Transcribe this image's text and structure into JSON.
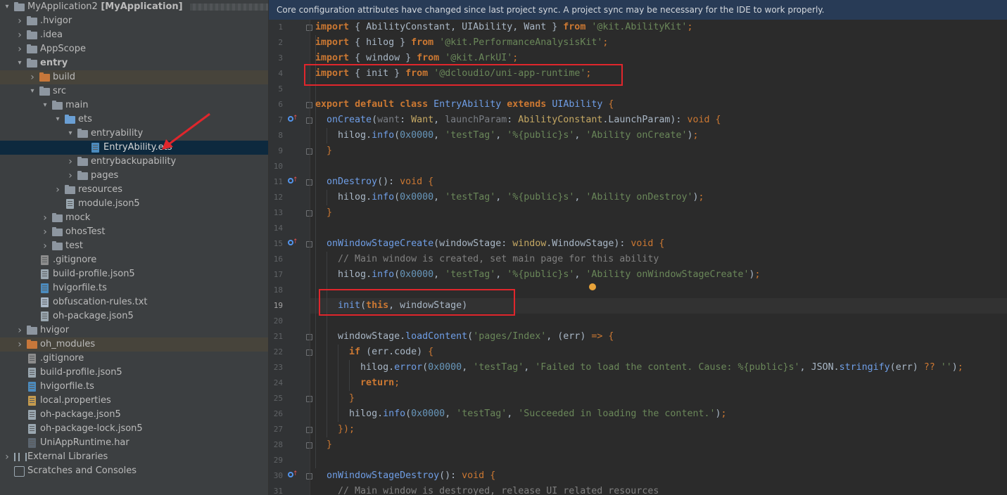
{
  "project": {
    "root_label": "MyApplication2",
    "root_module": "[MyApplication]",
    "items": [
      {
        "label": "MyApplication2",
        "icon": "folder-icon"
      },
      {
        "label": ".hvigor",
        "icon": "folder-icon"
      },
      {
        "label": ".idea",
        "icon": "folder-icon"
      },
      {
        "label": "AppScope",
        "icon": "folder-icon"
      },
      {
        "label": "entry",
        "icon": "folder-icon"
      },
      {
        "label": "build",
        "icon": "folder-orange-icon"
      },
      {
        "label": "src",
        "icon": "folder-icon"
      },
      {
        "label": "main",
        "icon": "folder-icon"
      },
      {
        "label": "ets",
        "icon": "folder-blue-icon"
      },
      {
        "label": "entryability",
        "icon": "folder-icon"
      },
      {
        "label": "EntryAbility.ets",
        "icon": "ets-file-icon"
      },
      {
        "label": "entrybackupability",
        "icon": "folder-icon"
      },
      {
        "label": "pages",
        "icon": "folder-icon"
      },
      {
        "label": "resources",
        "icon": "folder-icon"
      },
      {
        "label": "module.json5",
        "icon": "json-file-icon"
      },
      {
        "label": "mock",
        "icon": "folder-icon"
      },
      {
        "label": "ohosTest",
        "icon": "folder-icon"
      },
      {
        "label": "test",
        "icon": "folder-icon"
      },
      {
        "label": ".gitignore",
        "icon": "gitignore-file-icon"
      },
      {
        "label": "build-profile.json5",
        "icon": "json-file-icon"
      },
      {
        "label": "hvigorfile.ts",
        "icon": "ts-file-icon"
      },
      {
        "label": "obfuscation-rules.txt",
        "icon": "text-file-icon"
      },
      {
        "label": "oh-package.json5",
        "icon": "json-file-icon"
      },
      {
        "label": "hvigor",
        "icon": "folder-icon"
      },
      {
        "label": "oh_modules",
        "icon": "folder-orange-icon"
      },
      {
        "label": ".gitignore",
        "icon": "gitignore-file-icon"
      },
      {
        "label": "build-profile.json5",
        "icon": "json-file-icon"
      },
      {
        "label": "hvigorfile.ts",
        "icon": "ts-file-icon"
      },
      {
        "label": "local.properties",
        "icon": "properties-file-icon"
      },
      {
        "label": "oh-package.json5",
        "icon": "json-file-icon"
      },
      {
        "label": "oh-package-lock.json5",
        "icon": "json-file-icon"
      },
      {
        "label": "UniAppRuntime.har",
        "icon": "har-file-icon"
      },
      {
        "label": "External Libraries",
        "icon": "library-icon"
      },
      {
        "label": "Scratches and Consoles",
        "icon": "scratch-icon"
      }
    ]
  },
  "notice": {
    "text": "Core configuration attributes have changed since last project sync. A project sync may be necessary for the IDE to work properly."
  },
  "editor": {
    "line_numbers": [
      "1",
      "2",
      "3",
      "4",
      "5",
      "6",
      "7",
      "8",
      "9",
      "10",
      "11",
      "12",
      "13",
      "14",
      "15",
      "16",
      "17",
      "18",
      "19",
      "20",
      "21",
      "22",
      "23",
      "24",
      "25",
      "26",
      "27",
      "28",
      "29",
      "30",
      "31"
    ],
    "t": {
      "import": "import",
      "from": "from",
      "export": "export",
      "default": "default",
      "class": "class",
      "extends": "extends",
      "void": "void",
      "this": "this",
      "if": "if",
      "return": "return",
      "lb": "{ ",
      "rb": " }",
      "semi": ";",
      "l1_names": "AbilityConstant, UIAbility, Want",
      "l1_mod": "'@kit.AbilityKit'",
      "hilog": "hilog",
      "l2_mod": "'@kit.PerformanceAnalysisKit'",
      "window": "window",
      "l3_mod": "'@kit.ArkUI'",
      "init": "init",
      "l4_mod": "'@dcloudio/uni-app-runtime'",
      "EntryAbility": "EntryAbility",
      "UIAbility": "UIAbility",
      "onCreate": "onCreate",
      "want": "want",
      "Want": "Want",
      "launchParam": "launchParam",
      "AbilityConstant": "AbilityConstant",
      "LaunchParam": "LaunchParam",
      "info": "info",
      "error": "error",
      "hex": "0x0000",
      "testTag": "'testTag'",
      "fmt": "'%{public}s'",
      "msg_create": "'Ability onCreate'",
      "onDestroy": "onDestroy",
      "msg_destroy": "'Ability onDestroy'",
      "onWindowStageCreate": "onWindowStageCreate",
      "windowStage": "windowStage",
      "WindowStage": "WindowStage",
      "comment16": "// Main window is created, set main page for this ability",
      "msg_wsc": "'Ability onWindowStageCreate'",
      "loadContent": "loadContent",
      "page": "'pages/Index'",
      "err": "err",
      "code": "code",
      "msg_fail": "'Failed to load the content. Cause: %{public}s'",
      "JSON": "JSON",
      "stringify": "stringify",
      "empty": "''",
      "msg_ok": "'Succeeded in loading the content.'",
      "onWindowStageDestroy": "onWindowStageDestroy",
      "comment31": "// Main window is destroyed, release UI related resources"
    }
  }
}
